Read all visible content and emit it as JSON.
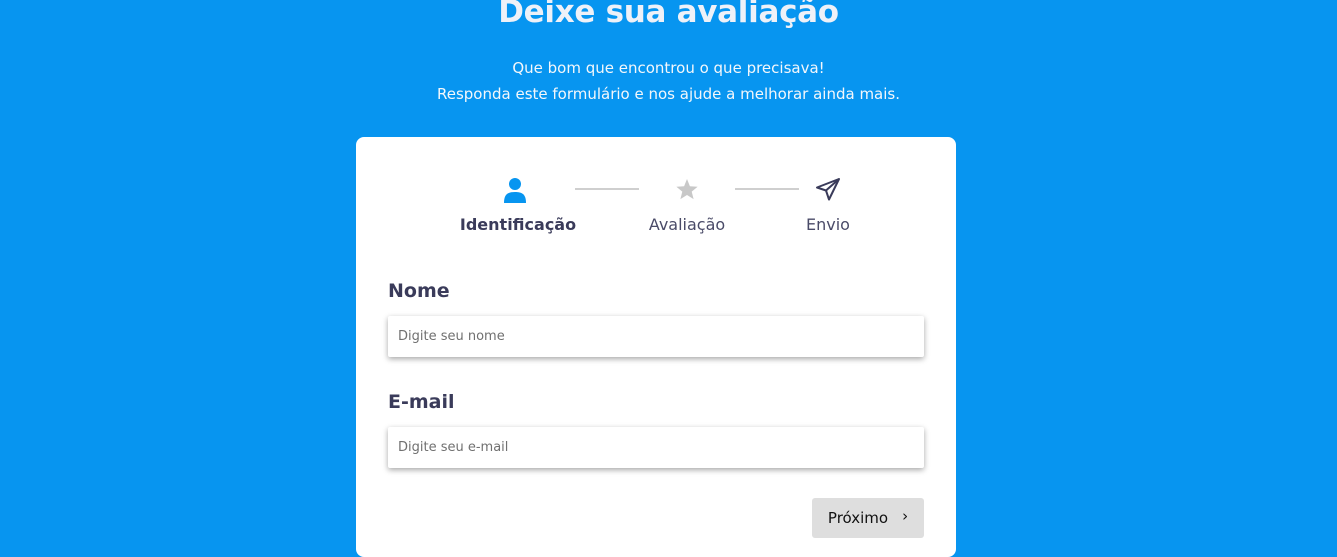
{
  "header": {
    "title": "Deixe sua avaliação",
    "subtitle_line1": "Que bom que encontrou o que precisava!",
    "subtitle_line2": "Responda este formulário e nos ajude a melhorar ainda mais."
  },
  "steps": [
    {
      "label": "Identificação",
      "icon": "user-icon",
      "active": true
    },
    {
      "label": "Avaliação",
      "icon": "star-icon",
      "active": false
    },
    {
      "label": "Envio",
      "icon": "send-icon",
      "active": false
    }
  ],
  "form": {
    "name_label": "Nome",
    "name_placeholder": "Digite seu nome",
    "name_value": "",
    "email_label": "E-mail",
    "email_placeholder": "Digite seu e-mail",
    "email_value": "",
    "next_label": "Próximo"
  },
  "colors": {
    "background": "#0795f0",
    "accent": "#0795f0",
    "inactive_icon": "#c8c8c8",
    "text_dark": "#3a3b5a"
  }
}
